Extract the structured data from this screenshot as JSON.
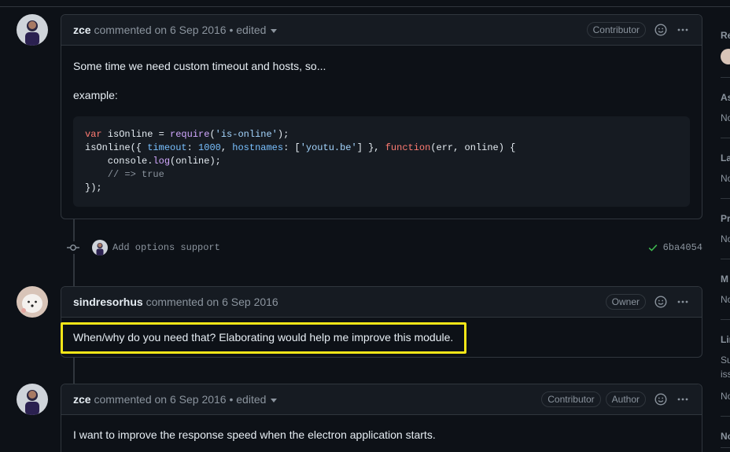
{
  "comments": [
    {
      "author": "zce",
      "meta": "commented on 6 Sep 2016 • edited",
      "badges": [
        "Contributor"
      ],
      "paragraphs": [
        "Some time we need custom timeout and hosts, so...",
        "example:"
      ]
    },
    {
      "author": "sindresorhus",
      "meta": "commented on 6 Sep 2016",
      "badges": [
        "Owner"
      ],
      "paragraphs": [
        "When/why do you need that? Elaborating would help me improve this module."
      ]
    },
    {
      "author": "zce",
      "meta": "commented on 6 Sep 2016 • edited",
      "badges": [
        "Contributor",
        "Author"
      ],
      "paragraphs": [
        "I want to improve the response speed when the electron application starts."
      ]
    }
  ],
  "code": {
    "line1": {
      "kw": "var",
      "a": " isOnline = ",
      "fn": "require",
      "b": "(",
      "str": "'is-online'",
      "c": ");"
    },
    "line2": {
      "a": "isOnline({ ",
      "p1": "timeout",
      "b": ": ",
      "num": "1000",
      "c": ", ",
      "p2": "hostnames",
      "d": ": [",
      "str": "'youtu.be'",
      "e": "] }, ",
      "kw": "function",
      "f": "(err, online) {"
    },
    "line3": {
      "a": "    console.",
      "fn": "log",
      "b": "(online);"
    },
    "line4": {
      "cm": "    // => true"
    },
    "line5": {
      "a": "});"
    }
  },
  "commit": {
    "message": "Add options support",
    "sha": "6ba4054"
  },
  "sidebar": {
    "items": [
      {
        "title": "Re",
        "value": ""
      },
      {
        "title": "As",
        "value": "No"
      },
      {
        "title": "La",
        "value": "No"
      },
      {
        "title": "Pr",
        "value": "No"
      },
      {
        "title": "M",
        "value": "No"
      },
      {
        "title": "Lin",
        "value": "Su"
      },
      {
        "title": "",
        "value": "iss"
      },
      {
        "title": "",
        "value": "No"
      },
      {
        "title": "No",
        "value": ""
      }
    ]
  },
  "colors": {
    "highlight": "#f5e618",
    "check": "#3fb950"
  }
}
